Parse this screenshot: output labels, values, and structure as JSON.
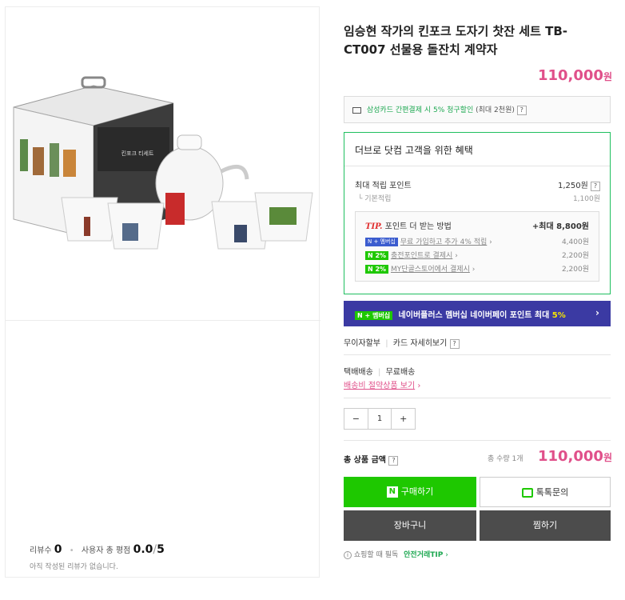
{
  "product": {
    "title": "임승현 작가의 킨포크 도자기 찻잔 세트 TB-CT007 선물용 돌잔치 계약자",
    "price": "110,000",
    "currency": "원"
  },
  "reviews": {
    "count_label": "리뷰수",
    "count": "0",
    "rating_label": "사용자 총 평점",
    "rating": "0.0",
    "rating_max": "5",
    "empty_text": "아직 작성된 리뷰가 없습니다."
  },
  "card_promo": {
    "text": "삼성카드 간편결제 시 5% 청구할인",
    "note": "(최대 2천원)"
  },
  "benefit": {
    "header": "더브로 닷컴 고객을 위한 혜택",
    "max_points_label": "최대 적립 포인트",
    "max_points_value": "1,250원",
    "base_label": "기본적립",
    "base_value": "1,100원",
    "tip_label": "TIP.",
    "tip_title": "포인트 더 받는 방법",
    "tip_max": "+최대 8,800원",
    "tip_rows": [
      {
        "badge": "N + 멤버십",
        "text": "무료 가입하고 추가 4% 적립",
        "value": "4,400원"
      },
      {
        "badge": "N 2%",
        "text": "충전포인트로 결제시",
        "value": "2,200원"
      },
      {
        "badge": "N 2%",
        "text": "MY단골스토어에서 결제시",
        "value": "2,200원"
      }
    ]
  },
  "banner": {
    "badge": "N + 멤버십",
    "text": "네이버플러스 멤버십 네이버페이 포인트 최대",
    "percent": "5%"
  },
  "installment": {
    "label": "무이자할부",
    "detail": "카드 자세히보기"
  },
  "shipping": {
    "type": "택배배송",
    "fee": "무료배송",
    "link": "배송비 절약상품 보기"
  },
  "quantity": {
    "value": "1",
    "minus": "−",
    "plus": "+"
  },
  "total": {
    "label": "총 상품 금액",
    "qty_label": "총 수량 1개",
    "price": "110,000",
    "currency": "원"
  },
  "buttons": {
    "buy": "구매하기",
    "talk": "톡톡문의",
    "cart": "장바구니",
    "wish": "찜하기"
  },
  "footer": {
    "note": "쇼핑할 때 필독",
    "link": "안전거래TIP"
  },
  "colors": {
    "price": "#e0508a",
    "green": "#1ec800",
    "dark": "#4c4c4c",
    "banner": "#3b3aa3"
  }
}
